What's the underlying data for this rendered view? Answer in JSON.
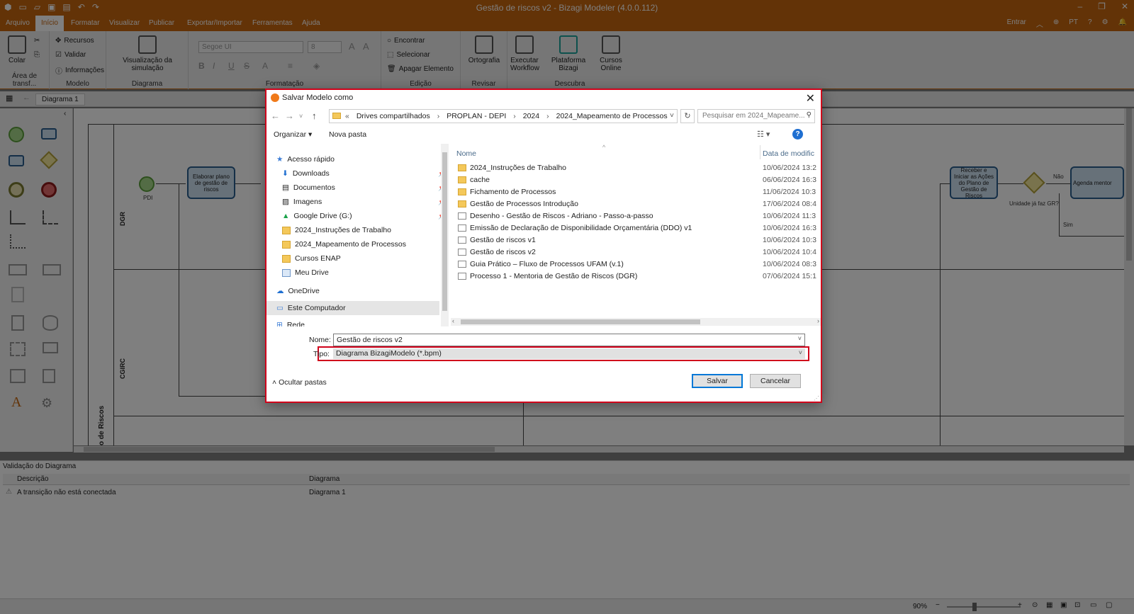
{
  "app": {
    "window_title": "Gestão de riscos v2 - Bizagi Modeler (4.0.0.112)",
    "menu": [
      "Arquivo",
      "Início",
      "Formatar",
      "Visualizar",
      "Publicar",
      "Exportar/Importar",
      "Ferramentas",
      "Ajuda"
    ],
    "menu_right": {
      "signin": "Entrar",
      "lang": "PT"
    },
    "ribbon": {
      "paste": "Colar",
      "clipboard_group": "Área de transf...",
      "resources": "Recursos",
      "validate": "Validar",
      "info": "Informações",
      "model_group": "Modelo",
      "simulation_view": "Visualização da simulação",
      "diagram_group": "Diagrama",
      "font_name": "Segoe UI",
      "font_size": "8",
      "format_group": "Formatação",
      "find": "Encontrar",
      "select": "Selecionar",
      "delete_element": "Apagar Elemento",
      "edit_group": "Edição",
      "spelling": "Ortografia",
      "review_group": "Revisar",
      "run_workflow": "Executar Workflow",
      "bizagi_platform": "Plataforma Bizagi",
      "online_courses": "Cursos Online",
      "discover_group": "Descubra"
    },
    "doc_tab": "Diagrama 1",
    "diagram": {
      "lane_dgr": "DGR",
      "lane_cgirc": "CGIRC",
      "pool_label": "o de Riscos",
      "task_1": "Elaborar plano de gestão de riscos",
      "start_label": "PDI",
      "task_2": "Receber e Iniciar as Ações do Plano de Gestão de Riscos",
      "gateway_label": "Unidade já faz GR?",
      "no_label": "Não",
      "yes_label": "Sim",
      "task_3": "Agenda mentor"
    },
    "validation": {
      "title": "Validação do Diagrama",
      "col_description": "Descrição",
      "col_diagram": "Diagrama",
      "row_description": "A transição não está conectada",
      "row_diagram": "Diagrama 1"
    },
    "status": {
      "zoom": "90%"
    }
  },
  "dialog": {
    "title": "Salvar Modelo como",
    "breadcrumb": [
      "Drives compartilhados",
      "PROPLAN - DEPI",
      "2024",
      "2024_Mapeamento de Processos"
    ],
    "search_placeholder": "Pesquisar em 2024_Mapeame...",
    "organize": "Organizar",
    "new_folder": "Nova pasta",
    "nav": [
      {
        "label": "Acesso rápido",
        "icon": "star-icon"
      },
      {
        "label": "Downloads",
        "icon": "download-icon",
        "pinned": true
      },
      {
        "label": "Documentos",
        "icon": "documents-icon",
        "pinned": true
      },
      {
        "label": "Imagens",
        "icon": "images-icon",
        "pinned": true
      },
      {
        "label": "Google Drive (G:)",
        "icon": "google-drive-icon",
        "pinned": true
      },
      {
        "label": "2024_Instruções de Trabalho",
        "icon": "folder-icon"
      },
      {
        "label": "2024_Mapeamento de Processos",
        "icon": "folder-icon"
      },
      {
        "label": "Cursos ENAP",
        "icon": "folder-icon"
      },
      {
        "label": "Meu Drive",
        "icon": "drive-icon"
      },
      {
        "label": "OneDrive",
        "icon": "cloud-icon"
      },
      {
        "label": "Este Computador",
        "icon": "computer-icon"
      },
      {
        "label": "Rede",
        "icon": "network-icon"
      }
    ],
    "columns": {
      "name": "Nome",
      "date": "Data de modific"
    },
    "files": [
      {
        "name": "2024_Instruções de Trabalho",
        "date": "10/06/2024 13:2",
        "type": "folder"
      },
      {
        "name": "cache",
        "date": "06/06/2024 16:3",
        "type": "folder"
      },
      {
        "name": "Fichamento de Processos",
        "date": "11/06/2024 10:3",
        "type": "folder"
      },
      {
        "name": "Gestão de Processos Introdução",
        "date": "17/06/2024 08:4",
        "type": "folder"
      },
      {
        "name": "Desenho - Gestão de Riscos - Adriano - Passo-a-passo",
        "date": "10/06/2024 11:3",
        "type": "file"
      },
      {
        "name": "Emissão de Declaração de Disponibilidade Orçamentária (DDO) v1",
        "date": "10/06/2024 16:3",
        "type": "file"
      },
      {
        "name": "Gestão de riscos v1",
        "date": "10/06/2024 10:3",
        "type": "file"
      },
      {
        "name": "Gestão de riscos v2",
        "date": "10/06/2024 10:4",
        "type": "file"
      },
      {
        "name": "Guia Prático – Fluxo de Processos UFAM (v.1)",
        "date": "10/06/2024 08:3",
        "type": "file"
      },
      {
        "name": "Processo 1 - Mentoria de Gestão de Riscos (DGR)",
        "date": "07/06/2024 15:1",
        "type": "file"
      }
    ],
    "name_label": "Nome:",
    "name_value": "Gestão de riscos v2",
    "type_label": "Tipo:",
    "type_value": "Diagrama BizagiModelo (*.bpm)",
    "hide_folders": "Ocultar pastas",
    "save": "Salvar",
    "cancel": "Cancelar"
  },
  "colors": {
    "brand": "#c7660f",
    "highlight": "#d0021b",
    "primary_button": "#0078d7"
  }
}
